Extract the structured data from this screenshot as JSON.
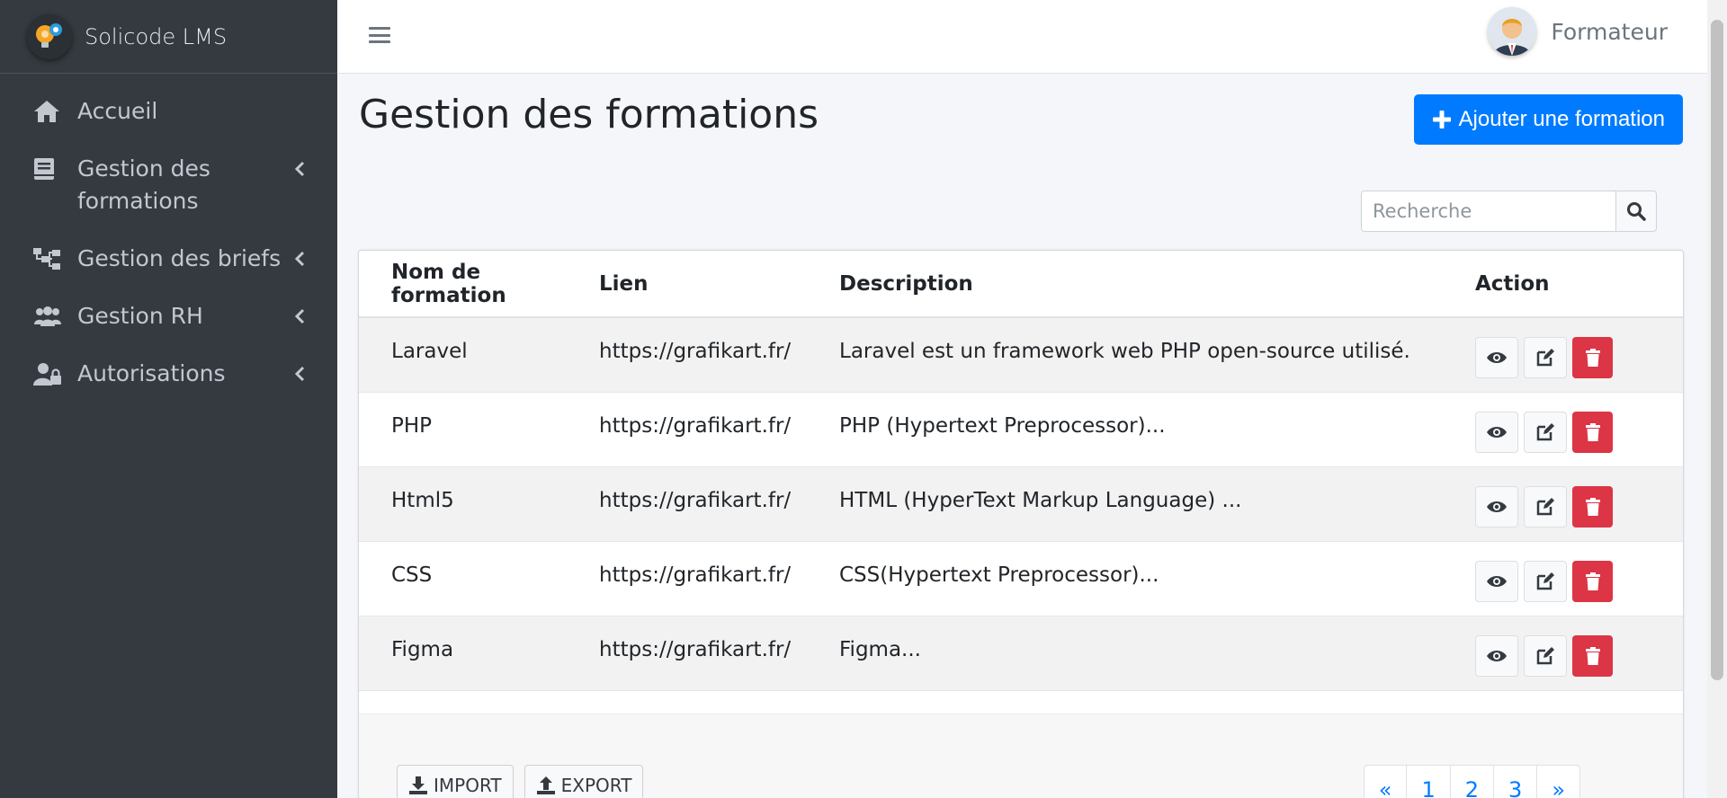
{
  "brand": {
    "name": "Solicode LMS"
  },
  "sidebar": {
    "items": [
      {
        "label": "Accueil",
        "icon": "home-icon",
        "has_children": false
      },
      {
        "label": "Gestion des formations",
        "icon": "book-icon",
        "has_children": true
      },
      {
        "label": "Gestion des briefs",
        "icon": "sitemap-icon",
        "has_children": true
      },
      {
        "label": "Gestion RH",
        "icon": "users-icon",
        "has_children": true
      },
      {
        "label": "Autorisations",
        "icon": "user-lock-icon",
        "has_children": true
      }
    ]
  },
  "header": {
    "user_name": "Formateur"
  },
  "page": {
    "title": "Gestion des formations",
    "add_button": "Ajouter une formation"
  },
  "search": {
    "placeholder": "Recherche"
  },
  "table": {
    "columns": [
      "Nom de formation",
      "Lien",
      "Description",
      "Action"
    ],
    "rows": [
      {
        "name": "Laravel",
        "link": "https://grafikart.fr/",
        "description": "Laravel est un framework web PHP open-source utilisé."
      },
      {
        "name": "PHP",
        "link": "https://grafikart.fr/",
        "description": "PHP (Hypertext Preprocessor)..."
      },
      {
        "name": "Html5",
        "link": "https://grafikart.fr/",
        "description": "HTML (HyperText Markup Language) ..."
      },
      {
        "name": "CSS",
        "link": "https://grafikart.fr/",
        "description": "CSS(Hypertext Preprocessor)..."
      },
      {
        "name": "Figma",
        "link": "https://grafikart.fr/",
        "description": "Figma..."
      }
    ]
  },
  "footer": {
    "import_label": "IMPORT",
    "export_label": "EXPORT",
    "pagination": {
      "prev": "«",
      "pages": [
        "1",
        "2",
        "3"
      ],
      "next": "»"
    }
  },
  "colors": {
    "sidebar_bg": "#343a40",
    "primary": "#007bff",
    "danger": "#dc3545"
  }
}
